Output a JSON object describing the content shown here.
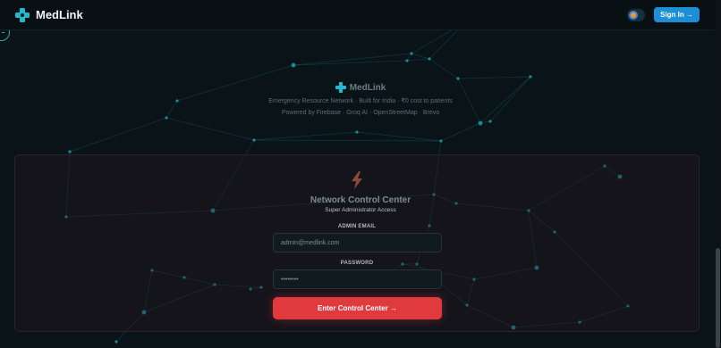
{
  "navbar": {
    "brand_name": "MedLink",
    "signin_label": "Sign In →"
  },
  "hero": {
    "brand_name": "MedLink",
    "tagline": "Emergency Resource Network · Built for India · ₹0 cost to patients",
    "powered_by": "Powered by Firebase · Groq AI · OpenStreetMap · Brevo"
  },
  "panel": {
    "title": "Network Control Center",
    "subtitle": "Super Administrator Access",
    "email_label": "ADMIN EMAIL",
    "email_placeholder": "admin@medlink.com",
    "password_label": "PASSWORD",
    "password_value": "••••••••",
    "submit_label": "Enter Control Center →"
  },
  "colors": {
    "background": "#0a1418",
    "accent": "#1d8fd6",
    "logo": "#22b8cf",
    "submit": "#e03a3e",
    "network": "#1fb6c9"
  },
  "icons": {
    "logo": "medical-cross-icon",
    "bolt": "lightning-bolt-icon",
    "theme": "theme-toggle-icon"
  }
}
